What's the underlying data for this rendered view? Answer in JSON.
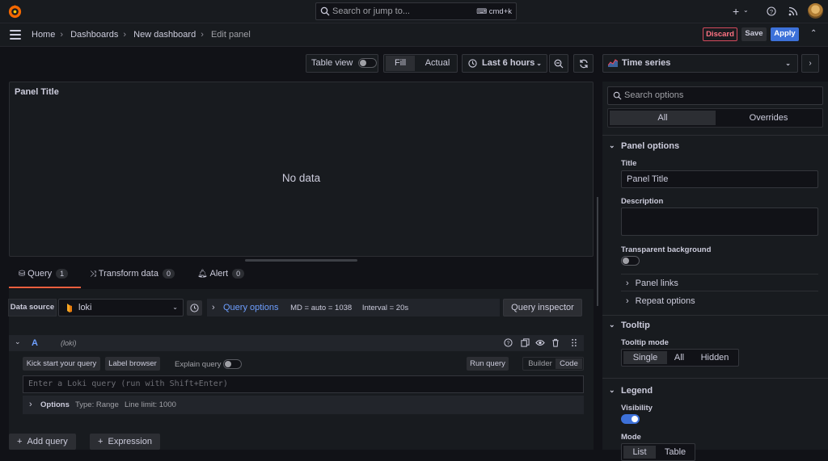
{
  "topbar": {
    "search_placeholder": "Search or jump to...",
    "search_shortcut": "cmd+k",
    "add_label": "+",
    "icons": [
      "grafana-logo-icon",
      "search-icon",
      "keyboard-icon",
      "plus-icon",
      "help-icon",
      "rss-icon",
      "avatar"
    ]
  },
  "breadcrumb": {
    "items": [
      "Home",
      "Dashboards",
      "New dashboard",
      "Edit panel"
    ]
  },
  "actions": {
    "discard": "Discard",
    "save": "Save",
    "apply": "Apply"
  },
  "toolbar": {
    "table_view": "Table view",
    "fill": "Fill",
    "actual": "Actual",
    "time_range": "Last 6 hours"
  },
  "panel": {
    "title": "Panel Title",
    "empty": "No data"
  },
  "tabs": [
    {
      "label": "Query",
      "count": "1"
    },
    {
      "label": "Transform data",
      "count": "0"
    },
    {
      "label": "Alert",
      "count": "0"
    }
  ],
  "query_bar": {
    "datasource_label": "Data source",
    "datasource_value": "loki",
    "query_options": "Query options",
    "md": "MD = auto = 1038",
    "interval": "Interval = 20s",
    "inspector": "Query inspector"
  },
  "query_row": {
    "ref": "A",
    "source": "(loki)",
    "kick_start": "Kick start your query",
    "label_browser": "Label browser",
    "explain": "Explain query",
    "run": "Run query",
    "builder": "Builder",
    "code": "Code",
    "placeholder": "Enter a Loki query (run with Shift+Enter)",
    "options": "Options",
    "type": "Type: Range",
    "line_limit": "Line limit: 1000"
  },
  "add": {
    "query": "Add query",
    "expression": "Expression"
  },
  "side": {
    "viz": "Time series",
    "search_placeholder": "Search options",
    "all": "All",
    "overrides": "Overrides",
    "panel_options": "Panel options",
    "title_label": "Title",
    "title_value": "Panel Title",
    "description_label": "Description",
    "transparent_label": "Transparent background",
    "panel_links": "Panel links",
    "repeat_options": "Repeat options",
    "tooltip": "Tooltip",
    "tooltip_mode": "Tooltip mode",
    "mode_options": [
      "Single",
      "All",
      "Hidden"
    ],
    "legend": "Legend",
    "visibility": "Visibility",
    "mode": "Mode",
    "legend_modes": [
      "List",
      "Table"
    ]
  },
  "colors": {
    "accent": "#3d71d9",
    "tab_active": "#f55f3e",
    "discard": "#d44a5d"
  }
}
